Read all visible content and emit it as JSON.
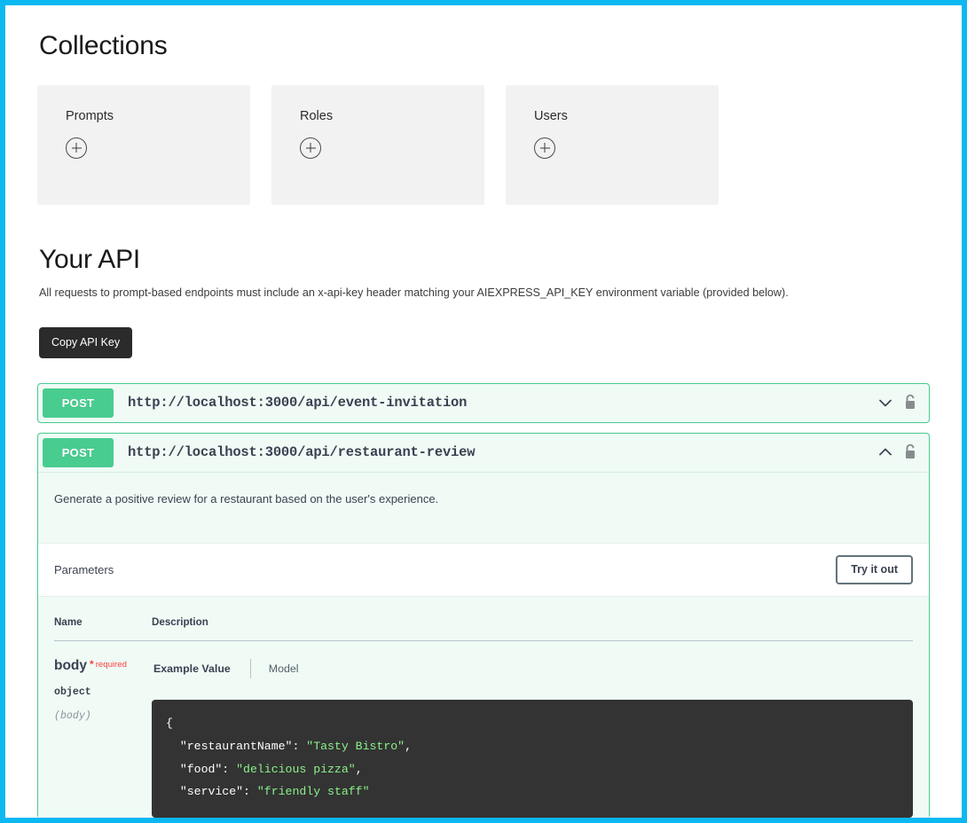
{
  "collections": {
    "heading": "Collections",
    "cards": [
      {
        "title": "Prompts",
        "add_icon": "plus-circle-icon"
      },
      {
        "title": "Roles",
        "add_icon": "plus-circle-icon"
      },
      {
        "title": "Users",
        "add_icon": "plus-circle-icon"
      }
    ]
  },
  "api": {
    "heading": "Your API",
    "description": "All requests to prompt-based endpoints must include an x-api-key header matching your AIEXPRESS_API_KEY environment variable (provided below).",
    "copy_key_label": "Copy API Key",
    "accent_green": "#49cc90",
    "frame_color": "#0cb8f2",
    "endpoints": [
      {
        "method": "POST",
        "path": "http://localhost:3000/api/event-invitation",
        "expanded": false,
        "chevron_icon": "chevron-down-icon",
        "lock_icon": "unlock-icon"
      },
      {
        "method": "POST",
        "path": "http://localhost:3000/api/restaurant-review",
        "expanded": true,
        "chevron_icon": "chevron-up-icon",
        "lock_icon": "unlock-icon",
        "description": "Generate a positive review for a restaurant based on the user's experience.",
        "parameters_label": "Parameters",
        "try_it_out_label": "Try it out",
        "table": {
          "headers": [
            "Name",
            "Description"
          ],
          "row": {
            "name": "body",
            "required_star": "*",
            "required_label": "required",
            "type": "object",
            "location": "(body)",
            "tab_example": "Example Value",
            "tab_model": "Model"
          }
        },
        "example_value": {
          "lines": [
            {
              "indent": 0,
              "text": "{",
              "type": "punct"
            },
            {
              "indent": 1,
              "key": "\"restaurantName\"",
              "value": "\"Tasty Bistro\"",
              "trail": ","
            },
            {
              "indent": 1,
              "key": "\"food\"",
              "value": "\"delicious pizza\"",
              "trail": ","
            },
            {
              "indent": 1,
              "key": "\"service\"",
              "value": "\"friendly staff\"",
              "trail": ""
            }
          ]
        }
      }
    ]
  }
}
